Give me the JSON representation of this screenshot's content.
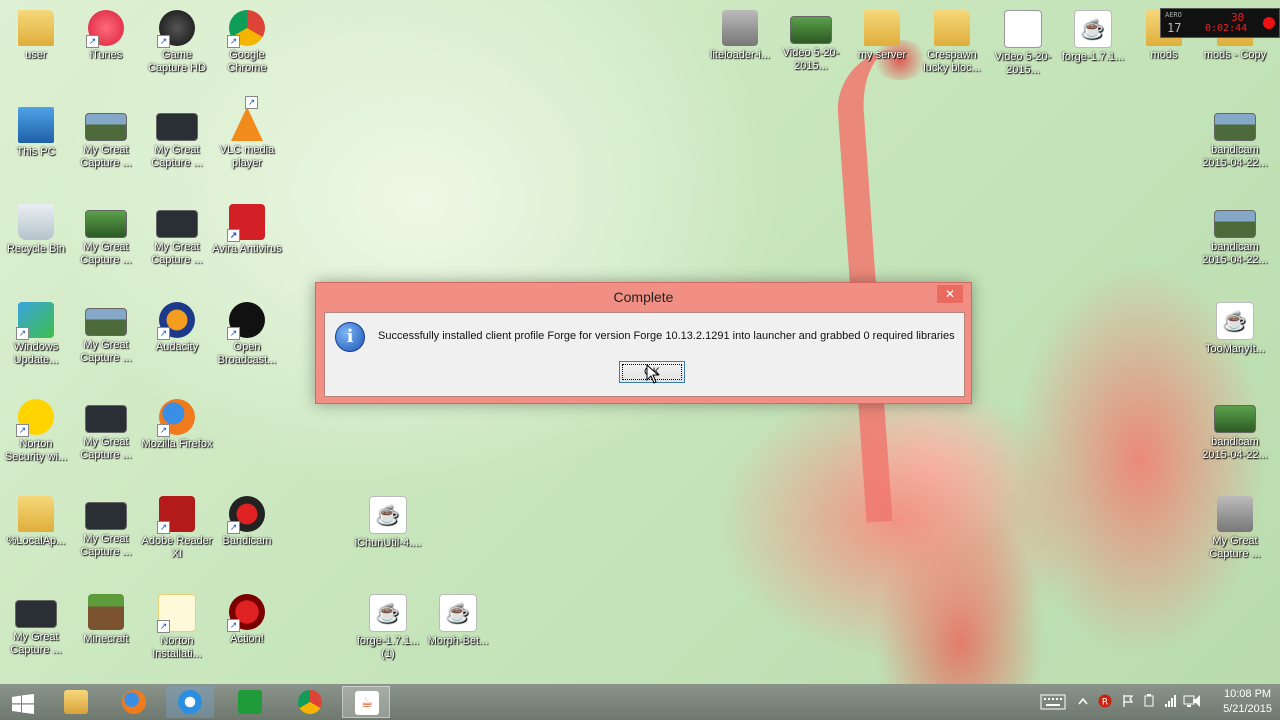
{
  "desktop": {
    "icons_left": [
      {
        "label": "user",
        "kind": "folder"
      },
      {
        "label": "iTunes",
        "kind": "itunes"
      },
      {
        "label": "Game Capture HD",
        "kind": "game"
      },
      {
        "label": "Google Chrome",
        "kind": "chrome"
      },
      {
        "label": "This PC",
        "kind": "pc"
      },
      {
        "label": "My Great Capture ...",
        "kind": "thumb-sky"
      },
      {
        "label": "My Great Capture ...",
        "kind": "thumb"
      },
      {
        "label": "VLC media player",
        "kind": "vlc"
      },
      {
        "label": "Recycle Bin",
        "kind": "bin"
      },
      {
        "label": "My Great Capture ...",
        "kind": "thumb-green"
      },
      {
        "label": "My Great Capture ...",
        "kind": "thumb"
      },
      {
        "label": "Avira Antivirus",
        "kind": "avira"
      },
      {
        "label": "Windows Update...",
        "kind": "winupd"
      },
      {
        "label": "My Great Capture ...",
        "kind": "thumb-sky"
      },
      {
        "label": "Audacity",
        "kind": "audacity"
      },
      {
        "label": "Open Broadcast...",
        "kind": "obs"
      },
      {
        "label": "Norton Security wi...",
        "kind": "norton"
      },
      {
        "label": "My Great Capture ...",
        "kind": "thumb"
      },
      {
        "label": "Mozilla Firefox",
        "kind": "firefox"
      },
      {
        "label": "%LocalAp...",
        "kind": "folder"
      },
      {
        "label": "My Great Capture ...",
        "kind": "thumb"
      },
      {
        "label": "Adobe Reader XI",
        "kind": "adobe"
      },
      {
        "label": "Bandicam",
        "kind": "bandicam"
      },
      {
        "label": "iChunUtil-4....",
        "kind": "java"
      },
      {
        "label": "My Great Capture ...",
        "kind": "thumb"
      },
      {
        "label": "Minecraft",
        "kind": "minecraft"
      },
      {
        "label": "Norton Installati...",
        "kind": "norton2"
      },
      {
        "label": "Action!",
        "kind": "action"
      },
      {
        "label": "forge-1.7.1... (1)",
        "kind": "java"
      },
      {
        "label": "Morph-Bet...",
        "kind": "java"
      }
    ],
    "icons_top": [
      {
        "label": "liteloader-i...",
        "kind": "cam"
      },
      {
        "label": "Video 5-20-2015...",
        "kind": "thumb-green"
      },
      {
        "label": "my server",
        "kind": "folder"
      },
      {
        "label": "Crespawn lucky bloc...",
        "kind": "folder"
      },
      {
        "label": "Video 5-20-2015...",
        "kind": "film"
      },
      {
        "label": "forge-1.7.1...",
        "kind": "java"
      },
      {
        "label": "mods",
        "kind": "folder"
      },
      {
        "label": "mods - Copy",
        "kind": "folder"
      }
    ],
    "icons_right": [
      {
        "label": "bandicam 2015-04-22...",
        "kind": "thumb-sky"
      },
      {
        "label": "bandicam 2015-04-22...",
        "kind": "thumb-sky"
      },
      {
        "label": "TooManyIt...",
        "kind": "java"
      },
      {
        "label": "bandicam 2015-04-22...",
        "kind": "thumb-green"
      },
      {
        "label": "My Great Capture ...",
        "kind": "cam"
      }
    ]
  },
  "recorder": {
    "label": "AERO",
    "fps": "17",
    "fps_alt": "30",
    "time": "0:02:44"
  },
  "dialog": {
    "title": "Complete",
    "close_glyph": "✕",
    "info_glyph": "i",
    "message": "Successfully installed client profile Forge for version Forge 10.13.2.1291 into launcher and grabbed 0 required libraries",
    "ok_label": "OK"
  },
  "taskbar": {
    "apps": [
      "start-button",
      "file-explorer",
      "firefox",
      "internet-explorer",
      "store",
      "chrome",
      "java"
    ],
    "active_app": "java",
    "clock_time": "10:08 PM",
    "clock_date": "5/21/2015"
  }
}
